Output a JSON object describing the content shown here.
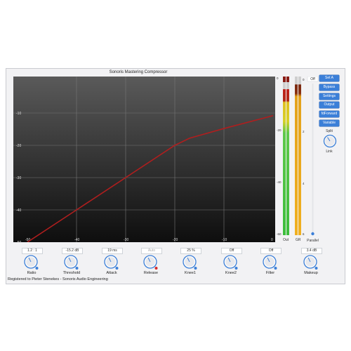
{
  "title": "Sonoris Mastering Compressor",
  "graph": {
    "y_ticks": [
      "-10",
      "-20",
      "-30",
      "-40",
      "-50"
    ],
    "x_ticks": [
      "-50",
      "-40",
      "-30",
      "-20",
      "-10",
      "0"
    ],
    "line_color": "#b01e1e",
    "curve": [
      [
        -50,
        -50
      ],
      [
        -40,
        -40
      ],
      [
        -30,
        -30
      ],
      [
        -20,
        -20
      ],
      [
        -17,
        -17.8
      ],
      [
        -10,
        -14.8
      ],
      [
        0,
        -10.8
      ]
    ]
  },
  "meters": {
    "out_label": "Out",
    "gr_label": "GR",
    "out_scale": [
      "0",
      "-20",
      "-40",
      "-60"
    ],
    "gr_scale": [
      "0",
      "2",
      "4",
      "6"
    ],
    "out_level": 0.92,
    "gr_level": 0.95
  },
  "parallel": {
    "value": "Off",
    "label": "Parallel",
    "level": 0.0
  },
  "buttons": [
    "Set A",
    "Bypass",
    "Settings",
    "Output",
    "fdForward",
    "Variable"
  ],
  "link": {
    "top_label": "Split",
    "bottom_label": "Link"
  },
  "knobs": [
    {
      "label": "Ratio",
      "value": "1.2 : 1",
      "dim": false
    },
    {
      "label": "Threshold",
      "value": "-15.2 dB",
      "dim": false
    },
    {
      "label": "Attack",
      "value": "19 ms",
      "dim": false
    },
    {
      "label": "Release",
      "value": "Auto",
      "dim": true
    },
    {
      "label": "Knee1",
      "value": "25 %",
      "dim": false
    },
    {
      "label": "Knee2",
      "value": "Off",
      "dim": false
    },
    {
      "label": "Filter",
      "value": "Off",
      "dim": false
    },
    {
      "label": "Makeup",
      "value": "3.4 dB",
      "dim": false
    }
  ],
  "footer": "Registered to Pieter Stenekes - Sonoris Audio Engineering",
  "colors": {
    "accent": "#3b7fd8",
    "knob_dot": "#3b7fd8",
    "release_dot": "#d62b2b"
  }
}
